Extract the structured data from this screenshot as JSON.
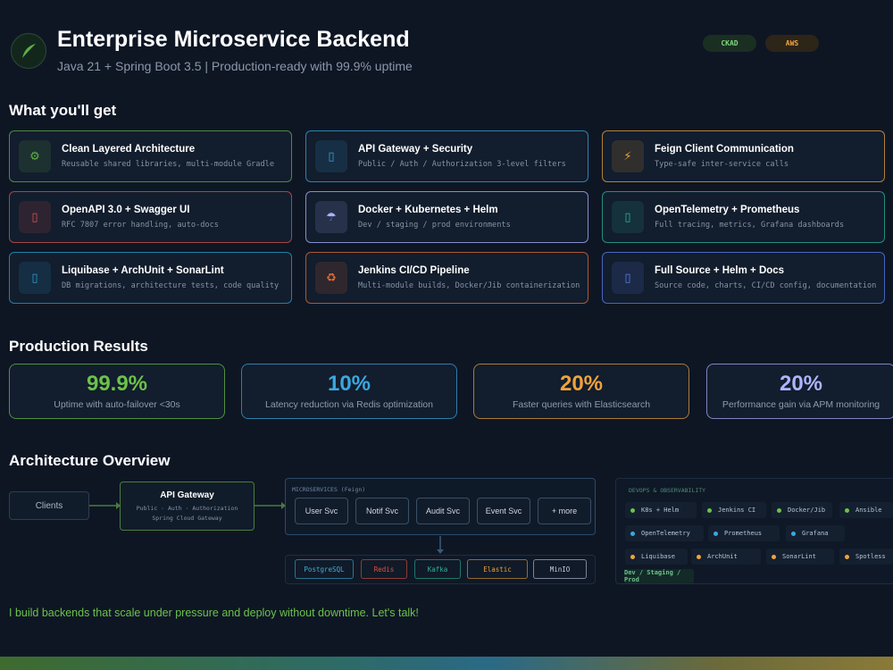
{
  "header": {
    "title": "Enterprise Microservice Backend",
    "subtitle": "Java 21 + Spring Boot 3.5 | Production-ready with 99.9% uptime",
    "logo_icon": "leaf-icon",
    "badges": [
      {
        "label": "CKAD",
        "color": "#7ed97e"
      },
      {
        "label": "AWS",
        "color": "#f0a340"
      }
    ]
  },
  "sections": {
    "features": "What you'll get",
    "results": "Production Results",
    "architecture": "Architecture Overview"
  },
  "features": [
    {
      "title": "Clean Layered Architecture",
      "desc": "Reusable shared libraries, multi-module Gradle",
      "icon": "gear-icon",
      "glyph": "⚙",
      "color": "#5fae4a"
    },
    {
      "title": "API Gateway + Security",
      "desc": "Public / Auth / Authorization 3-level filters",
      "icon": "shield-icon",
      "glyph": "▯",
      "color": "#3aa2d8"
    },
    {
      "title": "Feign Client Communication",
      "desc": "Type-safe inter-service calls",
      "icon": "lightning-icon",
      "glyph": "⚡",
      "color": "#e9a23b"
    },
    {
      "title": "OpenAPI 3.0 + Swagger UI",
      "desc": "RFC 7807 error handling, auto-docs",
      "icon": "document-icon",
      "glyph": "▯",
      "color": "#d9534f"
    },
    {
      "title": "Docker + Kubernetes + Helm",
      "desc": "Dev / staging / prod environments",
      "icon": "cloud-icon",
      "glyph": "☂",
      "color": "#a9b4ff"
    },
    {
      "title": "OpenTelemetry + Prometheus",
      "desc": "Full tracing, metrics, Grafana dashboards",
      "icon": "chart-icon",
      "glyph": "▯",
      "color": "#2bb39a"
    },
    {
      "title": "Liquibase + ArchUnit + SonarLint",
      "desc": "DB migrations, architecture tests, code quality",
      "icon": "database-icon",
      "glyph": "▯",
      "color": "#2a9fd0"
    },
    {
      "title": "Jenkins CI/CD Pipeline",
      "desc": "Multi-module builds, Docker/Jib containerization",
      "icon": "recycle-icon",
      "glyph": "♻",
      "color": "#e06b3a"
    },
    {
      "title": "Full Source + Helm + Docs",
      "desc": "Source code, charts, CI/CD config, documentation",
      "icon": "package-icon",
      "glyph": "▯",
      "color": "#5b7df0"
    }
  ],
  "results": [
    {
      "value": "99.9%",
      "label": "Uptime with auto-failover <30s",
      "color": "#6cc24a"
    },
    {
      "value": "10%",
      "label": "Latency reduction via Redis optimization",
      "color": "#3aa8e0"
    },
    {
      "value": "20%",
      "label": "Faster queries with Elasticsearch",
      "color": "#f0a33a"
    },
    {
      "value": "20%",
      "label": "Performance gain via APM monitoring",
      "color": "#aeb4ff"
    }
  ],
  "architecture": {
    "clients": "Clients",
    "gateway": {
      "title": "API Gateway",
      "line1": "Public · Auth · Authorization",
      "line2": "Spring Cloud Gateway"
    },
    "microservices_label": "MICROSERVICES (Feign)",
    "services": [
      "User Svc",
      "Notif Svc",
      "Audit Svc",
      "Event Svc",
      "+ more"
    ],
    "datastores": [
      {
        "name": "PostgreSQL",
        "color": "#3ab0d8"
      },
      {
        "name": "Redis",
        "color": "#e0523e"
      },
      {
        "name": "Kafka",
        "color": "#2bb39a"
      },
      {
        "name": "Elastic",
        "color": "#e9a23b"
      },
      {
        "name": "MinIO",
        "color": "#c6cbe0"
      }
    ],
    "devops_label": "DEVOPS & OBSERVABILITY",
    "devops_rows": [
      [
        {
          "name": "K8s + Helm",
          "color": "#6cc24a"
        },
        {
          "name": "Jenkins CI",
          "color": "#6cc24a"
        },
        {
          "name": "Docker/Jib",
          "color": "#6cc24a"
        },
        {
          "name": "Ansible",
          "color": "#6cc24a"
        }
      ],
      [
        {
          "name": "OpenTelemetry",
          "color": "#3aa8e0"
        },
        {
          "name": "Prometheus",
          "color": "#3aa8e0"
        },
        {
          "name": "Grafana",
          "color": "#3aa8e0"
        }
      ],
      [
        {
          "name": "Liquibase",
          "color": "#f0a33a"
        },
        {
          "name": "ArchUnit",
          "color": "#f0a33a"
        },
        {
          "name": "SonarLint",
          "color": "#f0a33a"
        },
        {
          "name": "Spotless",
          "color": "#f0a33a"
        }
      ]
    ],
    "env_label": "Dev / Staging / Prod"
  },
  "cta": "I build backends that scale under pressure and deploy without downtime. Let's talk!"
}
